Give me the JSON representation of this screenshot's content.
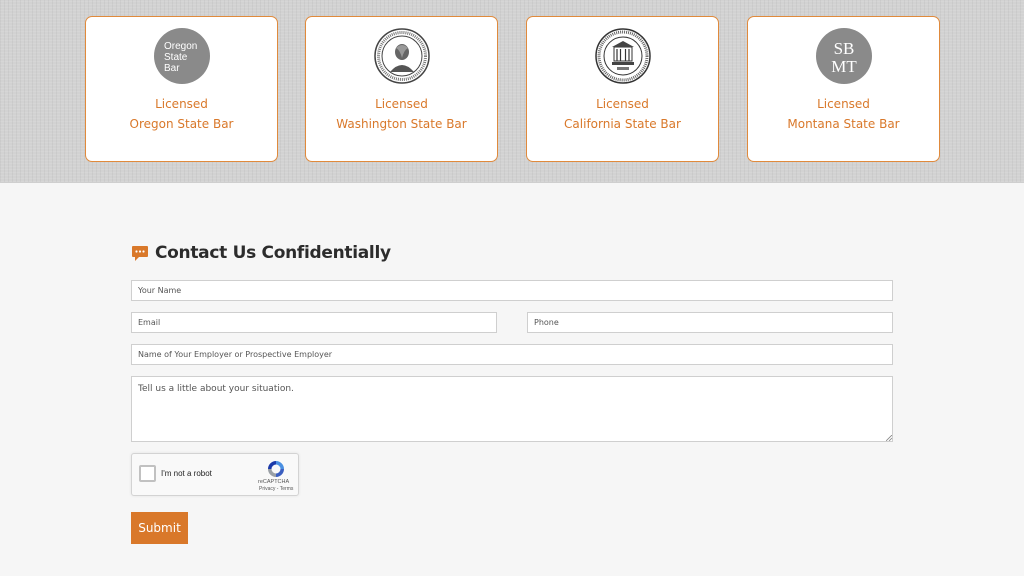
{
  "licenses": [
    {
      "status": "Licensed",
      "name": "Oregon State Bar",
      "seal_text": [
        "Oregon",
        "State",
        "Bar"
      ]
    },
    {
      "status": "Licensed",
      "name": "Washington State Bar",
      "seal_text": "WASHINGTON STATE BAR ASSOCIATION"
    },
    {
      "status": "Licensed",
      "name": "California State Bar",
      "seal_text": "STATE BAR OF CALIFORNIA"
    },
    {
      "status": "Licensed",
      "name": "Montana State Bar",
      "seal_text": [
        "SB",
        "MT"
      ]
    }
  ],
  "form": {
    "title": "Contact Us Confidentially",
    "name_placeholder": "Your Name",
    "email_placeholder": "Email",
    "phone_placeholder": "Phone",
    "employer_placeholder": "Name of Your Employer or Prospective Employer",
    "situation_placeholder": "Tell us a little about your situation.",
    "submit_label": "Submit"
  },
  "captcha": {
    "label": "I'm not a robot",
    "brand": "reCAPTCHA",
    "links": "Privacy - Terms"
  },
  "colors": {
    "accent": "#d9782a",
    "card_border": "#e08a3c",
    "seal_gray": "#8a8a8a"
  }
}
